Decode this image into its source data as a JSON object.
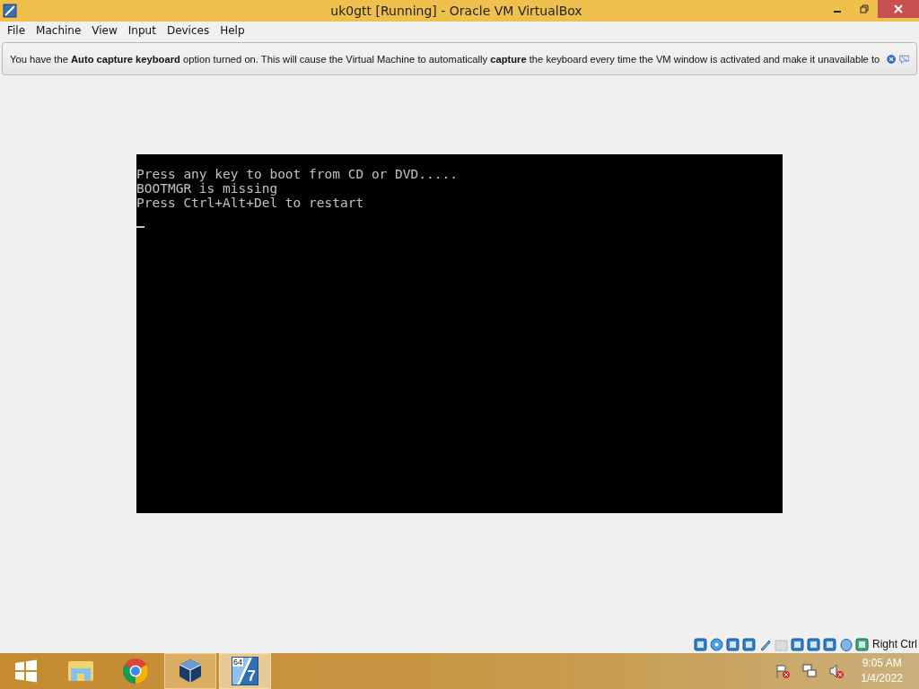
{
  "window": {
    "title": "uk0gtt [Running] - Oracle VM VirtualBox"
  },
  "menu": [
    "File",
    "Machine",
    "View",
    "Input",
    "Devices",
    "Help"
  ],
  "notice": {
    "text": "You have the **Auto capture keyboard** option turned on. This will cause the Virtual Machine to automatically **capture** the keyboard every time the VM window is activated and make it unavailable to"
  },
  "console": {
    "lines": [
      "Press any key to boot from CD or DVD.....",
      "BOOTMGR is missing",
      "Press Ctrl+Alt+Del to restart"
    ],
    "cursor": true
  },
  "status_bar": {
    "host_key": "Right Ctrl"
  },
  "taskbar": {
    "items": [
      {
        "kind": "start",
        "running": false,
        "selected": false
      },
      {
        "kind": "explorer",
        "running": false,
        "selected": false
      },
      {
        "kind": "chrome",
        "running": false,
        "selected": false
      },
      {
        "kind": "virtualbox",
        "running": true,
        "selected": false
      },
      {
        "kind": "windows7",
        "running": true,
        "selected": true,
        "badge": "64",
        "glyph": "7"
      }
    ],
    "clock": {
      "time": "9:05 AM",
      "date": "1/4/2022"
    }
  }
}
